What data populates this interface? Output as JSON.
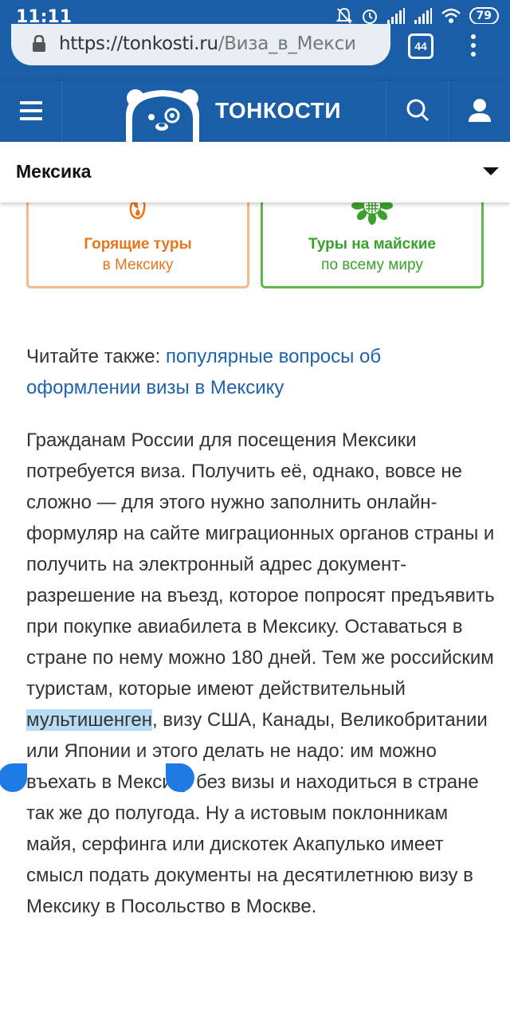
{
  "status_bar": {
    "time": "11:11",
    "battery": "79"
  },
  "browser": {
    "url_host": "https://tonkosti.ru",
    "url_path": "/Виза_в_Мекси",
    "tab_count": "44"
  },
  "site": {
    "logo_text": "ТОНКОСТИ"
  },
  "country_selector": {
    "label": "Мексика"
  },
  "promos": [
    {
      "title": "Горящие туры",
      "subtitle": "в Мексику",
      "color": "#e8751a"
    },
    {
      "title": "Туры на майские",
      "subtitle": "по всему миру",
      "color": "#3aa12f"
    }
  ],
  "article": {
    "read_also_prefix": "Читайте также: ",
    "read_also_link": "популярные вопросы об оформлении визы в Мексику",
    "para_before": "Гражданам России для посещения Мексики потребуется виза. Получить её, однако, вовсе не сложно — для этого нужно заполнить онлайн-формуляр на сайте миграционных органов страны и получить на электронный адрес документ-разрешение на въезд, которое попросят предъявить при покупке авиабилета в Мексику. Оставаться в стране по нему можно 180 дней. Тем же российским туристам, которые имеют действительный ",
    "para_selected": "мультишенген",
    "para_after": ", визу США, Канады, Великобритании или Японии и этого делать не надо: им можно въехать в Мексику без визы и находиться в стране так же до полугода. Ну а истовым поклонникам майя, серфинга или дискотек Акапулько имеет смысл подать документы на десятилетнюю визу в Мексику в Посольство в Москве."
  },
  "colors": {
    "brand_blue": "#1a5ea8",
    "link": "#1f63ad",
    "selection": "#b9dcf5"
  }
}
